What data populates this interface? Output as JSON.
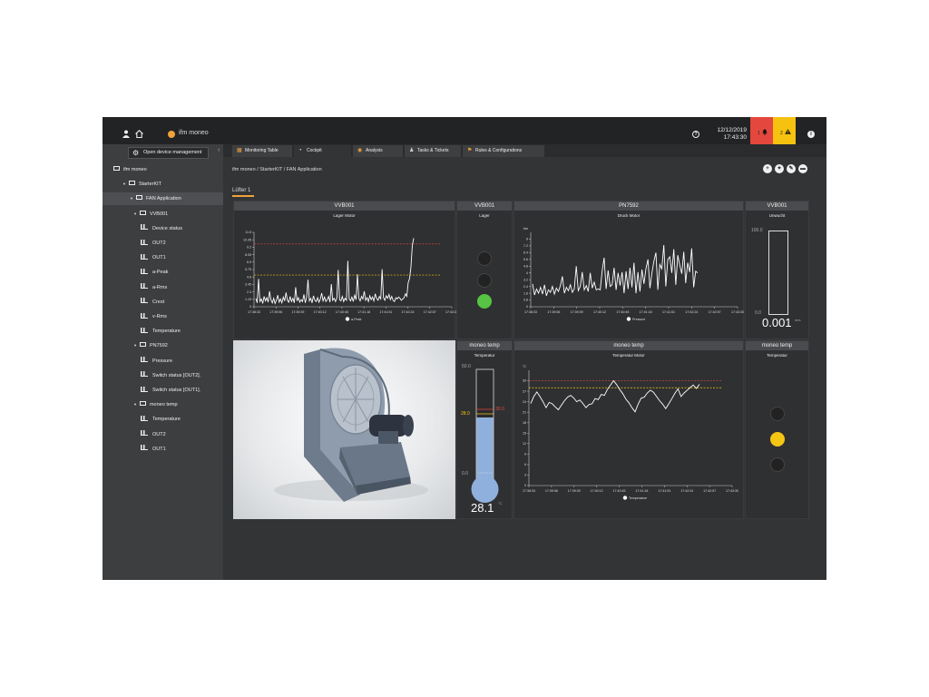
{
  "header": {
    "app_name": "ifm moneo",
    "date": "12/12/2019",
    "time": "17:43:30",
    "alarm_red_count": "1",
    "alarm_yellow_count": "2",
    "icons": [
      "user-icon",
      "home-icon",
      "help-icon",
      "bell-icon",
      "warning-icon",
      "info-icon"
    ]
  },
  "sidebar": {
    "open_device_label": "Open device management",
    "tree": [
      {
        "label": "ifm moneo",
        "level": 0
      },
      {
        "label": "StarterKIT",
        "level": 1
      },
      {
        "label": "FAN Application",
        "level": 2
      },
      {
        "label": "VVB001",
        "level": 3
      },
      {
        "label": "Device status",
        "level": 4
      },
      {
        "label": "OUT2",
        "level": 4
      },
      {
        "label": "OUT1",
        "level": 4
      },
      {
        "label": "a-Peak",
        "level": 4
      },
      {
        "label": "a-Rms",
        "level": 4
      },
      {
        "label": "Crest",
        "level": 4
      },
      {
        "label": "v-Rms",
        "level": 4
      },
      {
        "label": "Temperature",
        "level": 4
      },
      {
        "label": "PN7592",
        "level": 3
      },
      {
        "label": "Pressure",
        "level": 4
      },
      {
        "label": "Switch status [OUT2].",
        "level": 4
      },
      {
        "label": "Switch status [OUT1].",
        "level": 4
      },
      {
        "label": "moneo temp",
        "level": 3
      },
      {
        "label": "Temperature",
        "level": 4
      },
      {
        "label": "OUT2",
        "level": 4
      },
      {
        "label": "OUT1",
        "level": 4
      }
    ]
  },
  "tabs": [
    "Monitoring Table",
    "Cockpit",
    "Analysis",
    "Tasks & Tickets",
    "Rules & Configurations"
  ],
  "breadcrumb": "ifm moneo / StarterKIT / FAN Application",
  "dashboard_tab": "Lüfter 1",
  "panels": {
    "vvb_chart": {
      "header": "VVB001",
      "title": "Lager Motor",
      "legend": "a-Peak"
    },
    "vvb_lamps": {
      "header": "VVB001",
      "title": "Lager",
      "lamps": [
        "off",
        "off",
        "green"
      ]
    },
    "pn_chart": {
      "header": "PN7592",
      "title": "Druck Motor",
      "legend": "Pressure"
    },
    "vvb_gauge": {
      "header": "VVB001",
      "title": "Unwucht",
      "max": "100.0",
      "min": "0.0",
      "value": "0.001",
      "unit": "m/s"
    },
    "temp_thermo": {
      "header": "moneo temp",
      "title": "Temperatur",
      "max": "50.0",
      "min": "0.0",
      "yellow_limit": "28.0",
      "red_limit": "30.0",
      "value": "28.1",
      "unit": "°C",
      "fill_fraction": 0.562
    },
    "temp_chart": {
      "header": "moneo temp",
      "title": "Temperatur Motor",
      "legend": "Temperature"
    },
    "temp_lamps": {
      "header": "moneo temp",
      "title": "Temperatur",
      "lamps": [
        "off",
        "yellow",
        "off"
      ]
    }
  },
  "chart_data": [
    {
      "type": "line",
      "title": "Lager Motor",
      "series": [
        {
          "name": "a-Peak"
        }
      ],
      "x": [
        "17:38:33",
        "17:39:06",
        "17:39:39",
        "17:40:12",
        "17:40:45",
        "17:41:18",
        "17:41:51",
        "17:42:24",
        "17:42:57",
        "17:43:30"
      ],
      "yticks": [
        "11.5",
        "10.35",
        "9.2",
        "8.05",
        "6.9",
        "5.75",
        "4.6",
        "3.45",
        "2.3",
        "1.15",
        "0"
      ],
      "ylim": [
        0,
        11.5
      ],
      "red_limit": 9.7,
      "yellow_limit": 4.9,
      "values": [
        1.3,
        0.6,
        4.3,
        0.8,
        1.2,
        0.5,
        1.6,
        0.9,
        1.4,
        0.7,
        2.4,
        1.1,
        0.6,
        1.3,
        0.5,
        1.0,
        1.8,
        0.7,
        1.2,
        0.6,
        1.5,
        0.9,
        2.2,
        1.0,
        0.7,
        1.6,
        0.8,
        1.3,
        0.6,
        3.0,
        0.9,
        1.4,
        0.7,
        1.1,
        0.8,
        1.9,
        0.6,
        1.5,
        4.2,
        0.9,
        1.3,
        0.6,
        1.7,
        1.0,
        0.8,
        1.4,
        0.7,
        1.2,
        2.1,
        0.9,
        1.5,
        0.8,
        1.1,
        1.6,
        0.7,
        3.5,
        1.0,
        1.3,
        0.8,
        1.4,
        5.7,
        1.1,
        0.9,
        1.6,
        0.8,
        1.3,
        1.0,
        7.1,
        1.2,
        0.9,
        1.5,
        0.8,
        1.8,
        1.1,
        5.0,
        1.3,
        0.9,
        1.6,
        1.2,
        2.4,
        1.0,
        1.4,
        0.8,
        1.7,
        1.1,
        1.5,
        0.9,
        2.0,
        1.3,
        1.0,
        1.6,
        1.2,
        5.8,
        1.4,
        1.0,
        1.7,
        1.3,
        1.9,
        1.1,
        1.6,
        1.0,
        0.8,
        1.4,
        1.2,
        1.5,
        1.3,
        1.0,
        1.2,
        1.4,
        2.0,
        1.6,
        3.7,
        4.4,
        6.2,
        9.5,
        10.6
      ]
    },
    {
      "type": "line",
      "title": "Druck Motor",
      "series": [
        {
          "name": "Pressure"
        }
      ],
      "x": [
        "17:38:33",
        "17:39:06",
        "17:39:39",
        "17:40:12",
        "17:40:45",
        "17:41:18",
        "17:41:51",
        "17:42:24",
        "17:42:57",
        "17:43:30"
      ],
      "yticks": [
        "bar",
        "8",
        "7.2",
        "6.4",
        "5.6",
        "4.8",
        "4",
        "3.2",
        "2.4",
        "1.6",
        "0.8",
        "0"
      ],
      "ylim": [
        0,
        8.8
      ],
      "values": [
        2.7,
        1.4,
        2.1,
        1.6,
        2.3,
        1.5,
        2.6,
        1.3,
        2.0,
        1.7,
        2.4,
        1.5,
        2.2,
        1.8,
        2.5,
        3.6,
        1.6,
        2.3,
        1.9,
        2.6,
        1.7,
        2.1,
        4.8,
        1.9,
        2.4,
        4.1,
        2.0,
        2.5,
        1.8,
        4.0,
        2.2,
        2.9,
        2.0,
        2.1,
        2.0,
        4.2,
        5.8,
        2.1,
        4.3,
        2.4,
        2.6,
        4.6,
        2.0,
        4.0,
        2.5,
        4.1,
        1.6,
        4.2,
        2.1,
        4.6,
        2.3,
        5.2,
        1.6,
        4.1,
        1.8,
        4.4,
        2.7,
        4.5,
        5.6,
        2.2,
        4.0,
        5.4,
        6.4,
        2.0,
        5.0,
        4.5,
        7.3,
        2.4,
        5.6,
        5.9,
        4.0,
        6.8,
        2.6,
        6.1,
        4.9,
        3.9,
        6.5,
        2.8,
        5.2,
        4.1,
        6.9,
        2.3,
        4.2,
        4.0
      ]
    },
    {
      "type": "line",
      "title": "Temperatur Motor",
      "series": [
        {
          "name": "Temperature"
        }
      ],
      "x": [
        "17:38:33",
        "17:39:06",
        "17:39:39",
        "17:40:12",
        "17:40:45",
        "17:41:18",
        "17:41:51",
        "17:42:24",
        "17:42:57",
        "17:43:30"
      ],
      "yticks": [
        "°C",
        "30",
        "27",
        "24",
        "21",
        "18",
        "15",
        "12",
        "9",
        "6",
        "3",
        "0"
      ],
      "ylim": [
        0,
        33
      ],
      "red_limit": 30,
      "yellow_limit": 28,
      "values": [
        23.5,
        25.5,
        26.8,
        25.5,
        24.0,
        22.3,
        23.8,
        23.4,
        22.5,
        21.7,
        23.0,
        24.3,
        25.3,
        25.8,
        25.1,
        24.0,
        24.5,
        23.5,
        22.3,
        23.2,
        23.4,
        24.9,
        24.6,
        26.1,
        25.8,
        27.5,
        28.8,
        30.0,
        28.9,
        27.5,
        26.3,
        24.8,
        23.7,
        22.3,
        21.1,
        23.3,
        25.0,
        25.3,
        26.5,
        27.3,
        26.7,
        25.5,
        24.3,
        23.3,
        22.0,
        23.4,
        24.9,
        26.4,
        27.7,
        25.5,
        26.5,
        27.3,
        28.1,
        28.8,
        27.8,
        29.0
      ]
    }
  ]
}
